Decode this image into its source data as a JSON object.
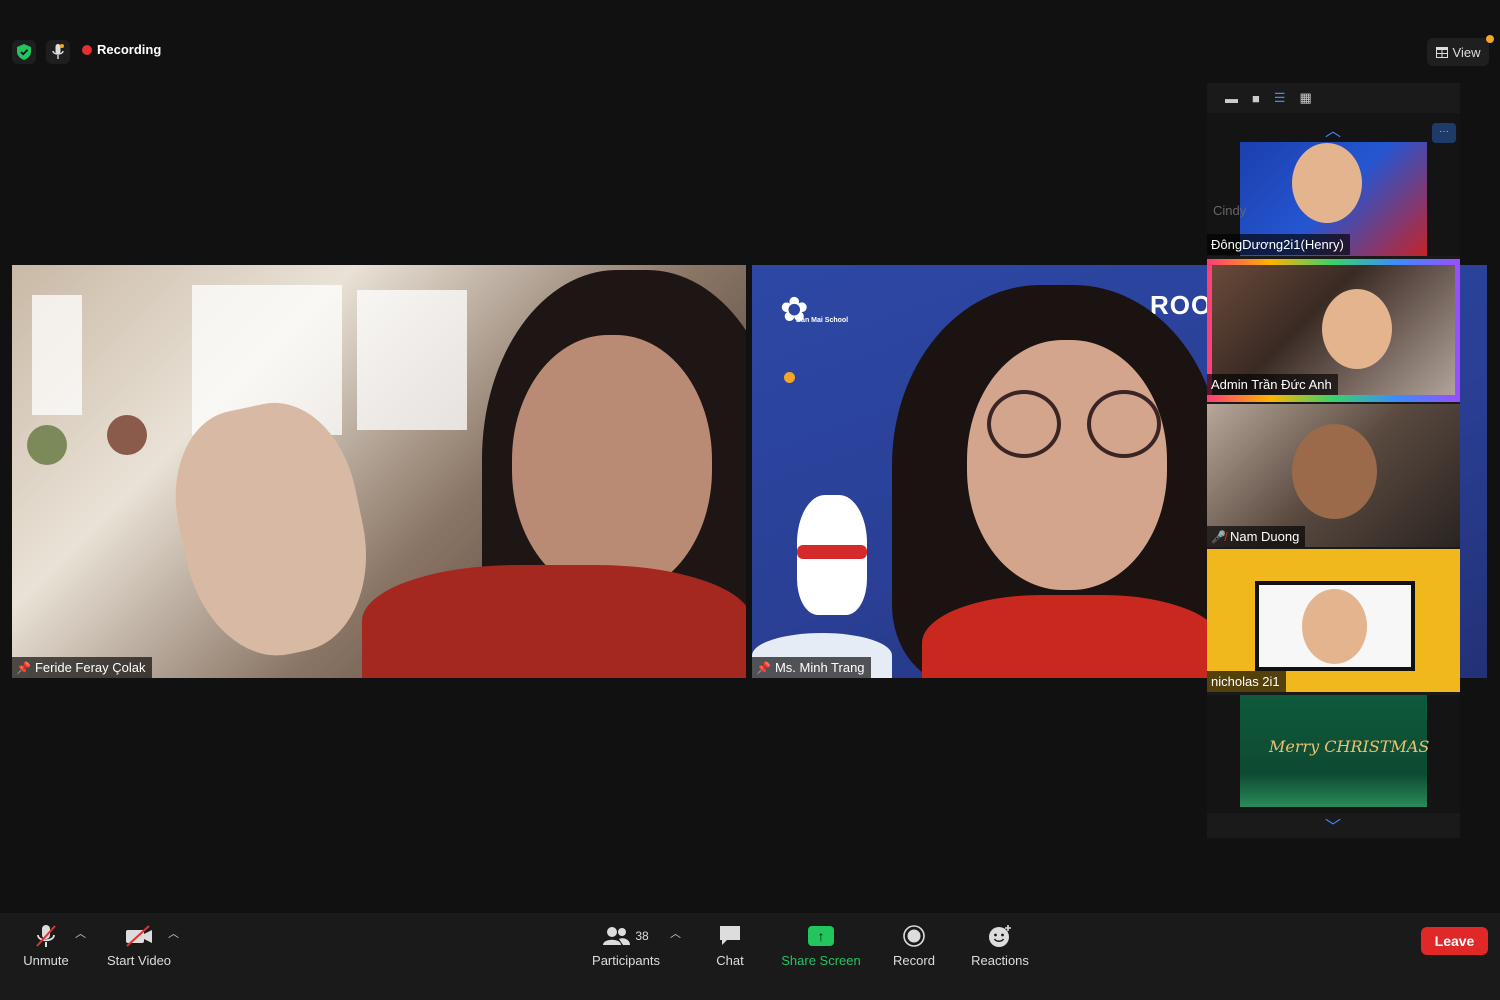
{
  "status": {
    "recording_label": "Recording",
    "view_label": "View",
    "colors": {
      "recording": "#e5302f",
      "shield": "#22c55e",
      "accent": "#3b8cff"
    }
  },
  "main_videos": [
    {
      "name": "Feride Feray Çolak"
    },
    {
      "name": "Ms. Minh Trang",
      "background_text": "ROOM",
      "logo_text": "Ban Mai School"
    }
  ],
  "gallery": {
    "tiles": [
      {
        "name": "ĐôngDương2i1(Henry)"
      },
      {
        "name": "Admin Trần Đức Anh"
      },
      {
        "name": "Nam Duong",
        "muted": true
      },
      {
        "name": "nicholas 2i1"
      },
      {
        "name": "Cindy",
        "overlay_text": "Merry CHRISTMAS"
      }
    ]
  },
  "toolbar": {
    "unmute": "Unmute",
    "start_video": "Start Video",
    "participants": "Participants",
    "participant_count": "38",
    "chat": "Chat",
    "share_screen": "Share Screen",
    "record": "Record",
    "reactions": "Reactions",
    "leave": "Leave",
    "colors": {
      "share": "#22c55e",
      "leave": "#e02828"
    }
  }
}
